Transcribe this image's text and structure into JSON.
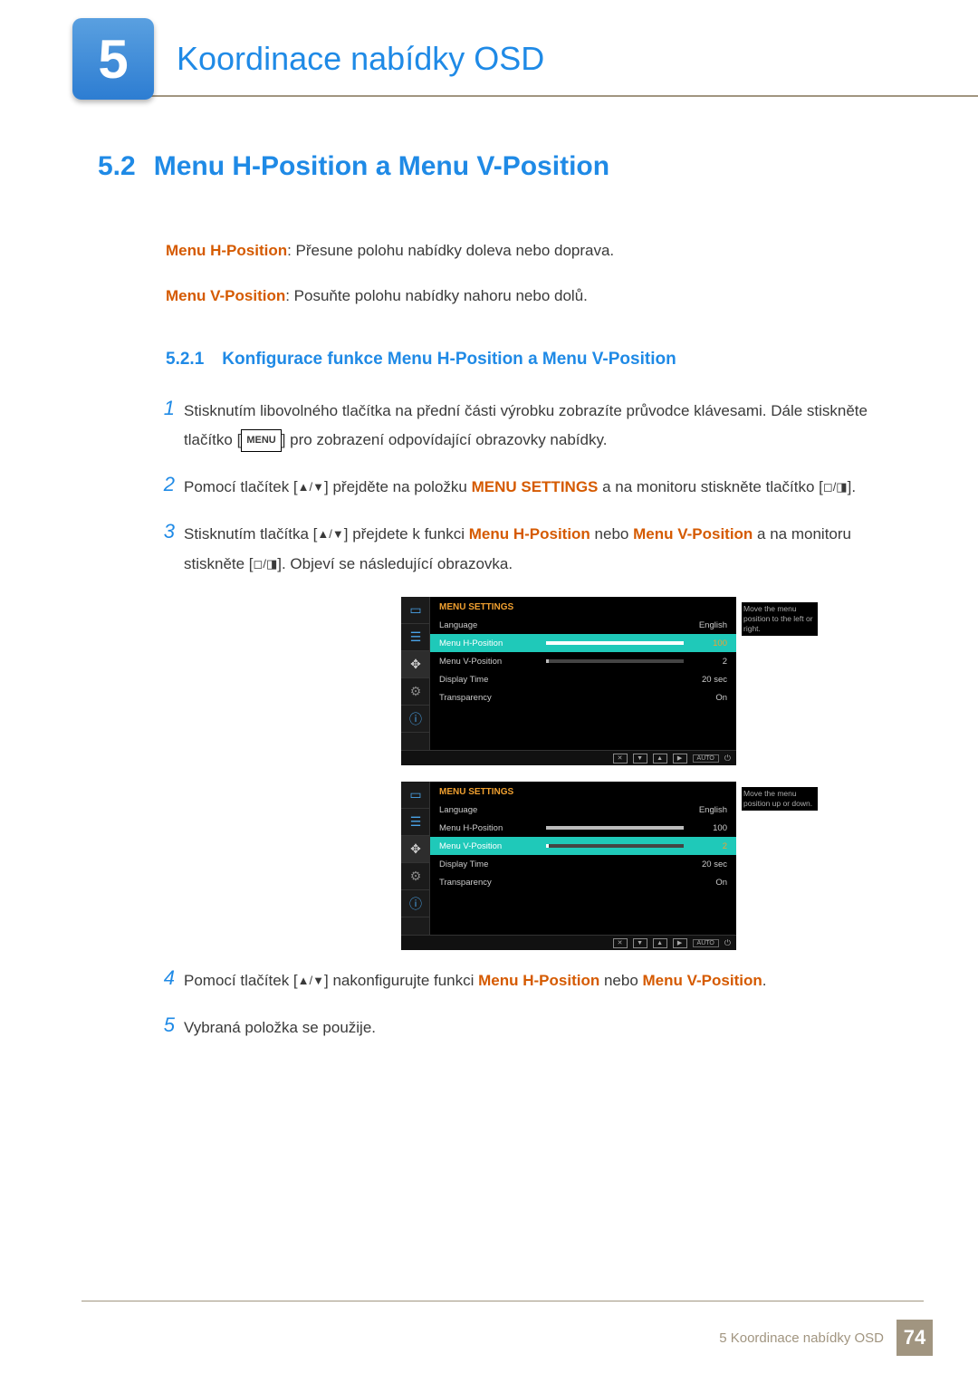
{
  "chapter": {
    "number": "5",
    "title": "Koordinace nabídky OSD"
  },
  "section": {
    "number": "5.2",
    "title": "Menu H-Position a Menu V-Position"
  },
  "intro": {
    "h_label": "Menu H-Position",
    "h_text": ": Přesune polohu nabídky doleva nebo doprava.",
    "v_label": "Menu V-Position",
    "v_text": ": Posuňte polohu nabídky nahoru nebo dolů."
  },
  "subsection": {
    "number": "5.2.1",
    "title": "Konfigurace funkce Menu H-Position a Menu V-Position"
  },
  "steps": {
    "s1a": "Stisknutím libovolného tlačítka na přední části výrobku zobrazíte průvodce klávesami. Dále stiskněte tlačítko [",
    "s1b": "] pro zobrazení odpovídající obrazovky nabídky.",
    "menu_key": "MENU",
    "s2a": "Pomocí tlačítek [",
    "s2b": "] přejděte na položku ",
    "s2c": "MENU SETTINGS",
    "s2d": " a na monitoru stiskněte tlačítko [",
    "s2e": "].",
    "s3a": "Stisknutím tlačítka [",
    "s3b": "] přejdete k funkci ",
    "s3c": "Menu H-Position",
    "s3d": " nebo ",
    "s3e": "Menu V-Position",
    "s3f": " a na monitoru stiskněte [",
    "s3g": "]. Objeví se následující obrazovka.",
    "s4a": "Pomocí tlačítek [",
    "s4b": "] nakonfigurujte funkci ",
    "s4c": "Menu H-Position",
    "s4d": " nebo ",
    "s4e": "Menu V-Position",
    "s4f": ".",
    "s5": "Vybraná položka se použije.",
    "n1": "1",
    "n2": "2",
    "n3": "3",
    "n4": "4",
    "n5": "5"
  },
  "osd": {
    "title": "MENU SETTINGS",
    "rows": {
      "lang_l": "Language",
      "lang_v": "English",
      "hpos_l": "Menu H-Position",
      "hpos_v": "100",
      "vpos_l": "Menu V-Position",
      "vpos_v": "2",
      "disp_l": "Display Time",
      "disp_v": "20 sec",
      "trans_l": "Transparency",
      "trans_v": "On"
    },
    "tip_h": "Move the menu position to the left or right.",
    "tip_v": "Move the menu position up or down.",
    "auto": "AUTO"
  },
  "footer": {
    "text": "5 Koordinace nabídky OSD",
    "page": "74"
  }
}
